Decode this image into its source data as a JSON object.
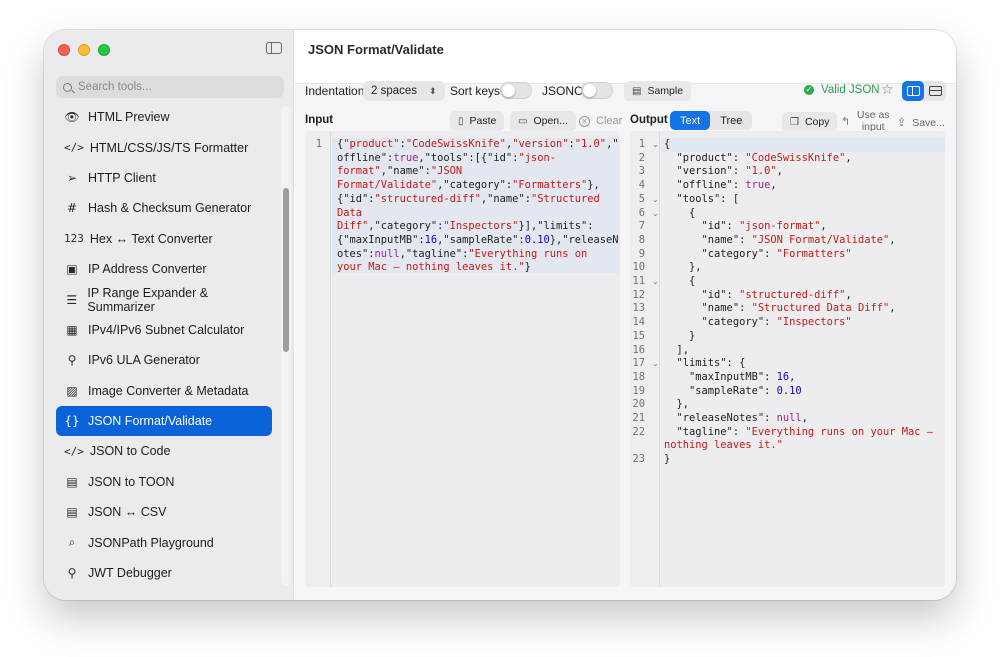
{
  "window": {
    "title": "JSON Format/Validate"
  },
  "sidebar": {
    "search_placeholder": "Search tools...",
    "items": [
      {
        "label": "HTML Preview",
        "icon": "eye-icon",
        "glyph": "👁"
      },
      {
        "label": "HTML/CSS/JS/TS Formatter",
        "icon": "code-brackets-icon",
        "glyph": "</>"
      },
      {
        "label": "HTTP Client",
        "icon": "paper-plane-icon",
        "glyph": "➢"
      },
      {
        "label": "Hash & Checksum Generator",
        "icon": "hash-icon",
        "glyph": "#"
      },
      {
        "label": "Hex ↔ Text Converter",
        "icon": "numbers-icon",
        "glyph": "123"
      },
      {
        "label": "IP Address Converter",
        "icon": "ip-box-icon",
        "glyph": "▣"
      },
      {
        "label": "IP Range Expander & Summarizer",
        "icon": "list-icon",
        "glyph": "☰"
      },
      {
        "label": "IPv4/IPv6 Subnet Calculator",
        "icon": "grid-icon",
        "glyph": "▦"
      },
      {
        "label": "IPv6 ULA Generator",
        "icon": "key-icon",
        "glyph": "⚲"
      },
      {
        "label": "Image Converter & Metadata",
        "icon": "photo-icon",
        "glyph": "▨"
      },
      {
        "label": "JSON Format/Validate",
        "icon": "braces-icon",
        "glyph": "{}"
      },
      {
        "label": "JSON to Code",
        "icon": "code-brackets-icon",
        "glyph": "</>"
      },
      {
        "label": "JSON to TOON",
        "icon": "table-icon",
        "glyph": "▤"
      },
      {
        "label": "JSON ↔ CSV",
        "icon": "table-icon",
        "glyph": "▤"
      },
      {
        "label": "JSONPath Playground",
        "icon": "magnifier-icon",
        "glyph": "⌕"
      },
      {
        "label": "JWT Debugger",
        "icon": "key-icon",
        "glyph": "⚲"
      }
    ],
    "active_index": 10
  },
  "toolbar": {
    "indentation_label": "Indentation",
    "indentation_value": "2 spaces",
    "sort_keys_label": "Sort keys",
    "sort_keys_on": false,
    "jsonc_label": "JSONC",
    "jsonc_on": false,
    "sample_label": "Sample",
    "valid_label": "Valid JSON"
  },
  "input": {
    "title": "Input",
    "paste_label": "Paste",
    "open_label": "Open...",
    "clear_label": "Clear",
    "line_numbers": [
      "1"
    ]
  },
  "output": {
    "title": "Output",
    "tabs": [
      "Text",
      "Tree"
    ],
    "active_tab": "Text",
    "copy_label": "Copy",
    "use_as_input_label": "Use as input",
    "save_label": "Save...",
    "line_numbers": [
      "1",
      "2",
      "3",
      "4",
      "5",
      "6",
      "7",
      "8",
      "9",
      "10",
      "11",
      "12",
      "13",
      "14",
      "15",
      "16",
      "17",
      "18",
      "19",
      "20",
      "21",
      "22",
      "",
      "23"
    ]
  },
  "colors": {
    "accent": "#1473e6",
    "sidebar_active": "#0a63d8",
    "valid_green": "#2d9f4a",
    "string": "#c41a16",
    "number": "#1c00cf",
    "keyword": "#9b2393"
  }
}
